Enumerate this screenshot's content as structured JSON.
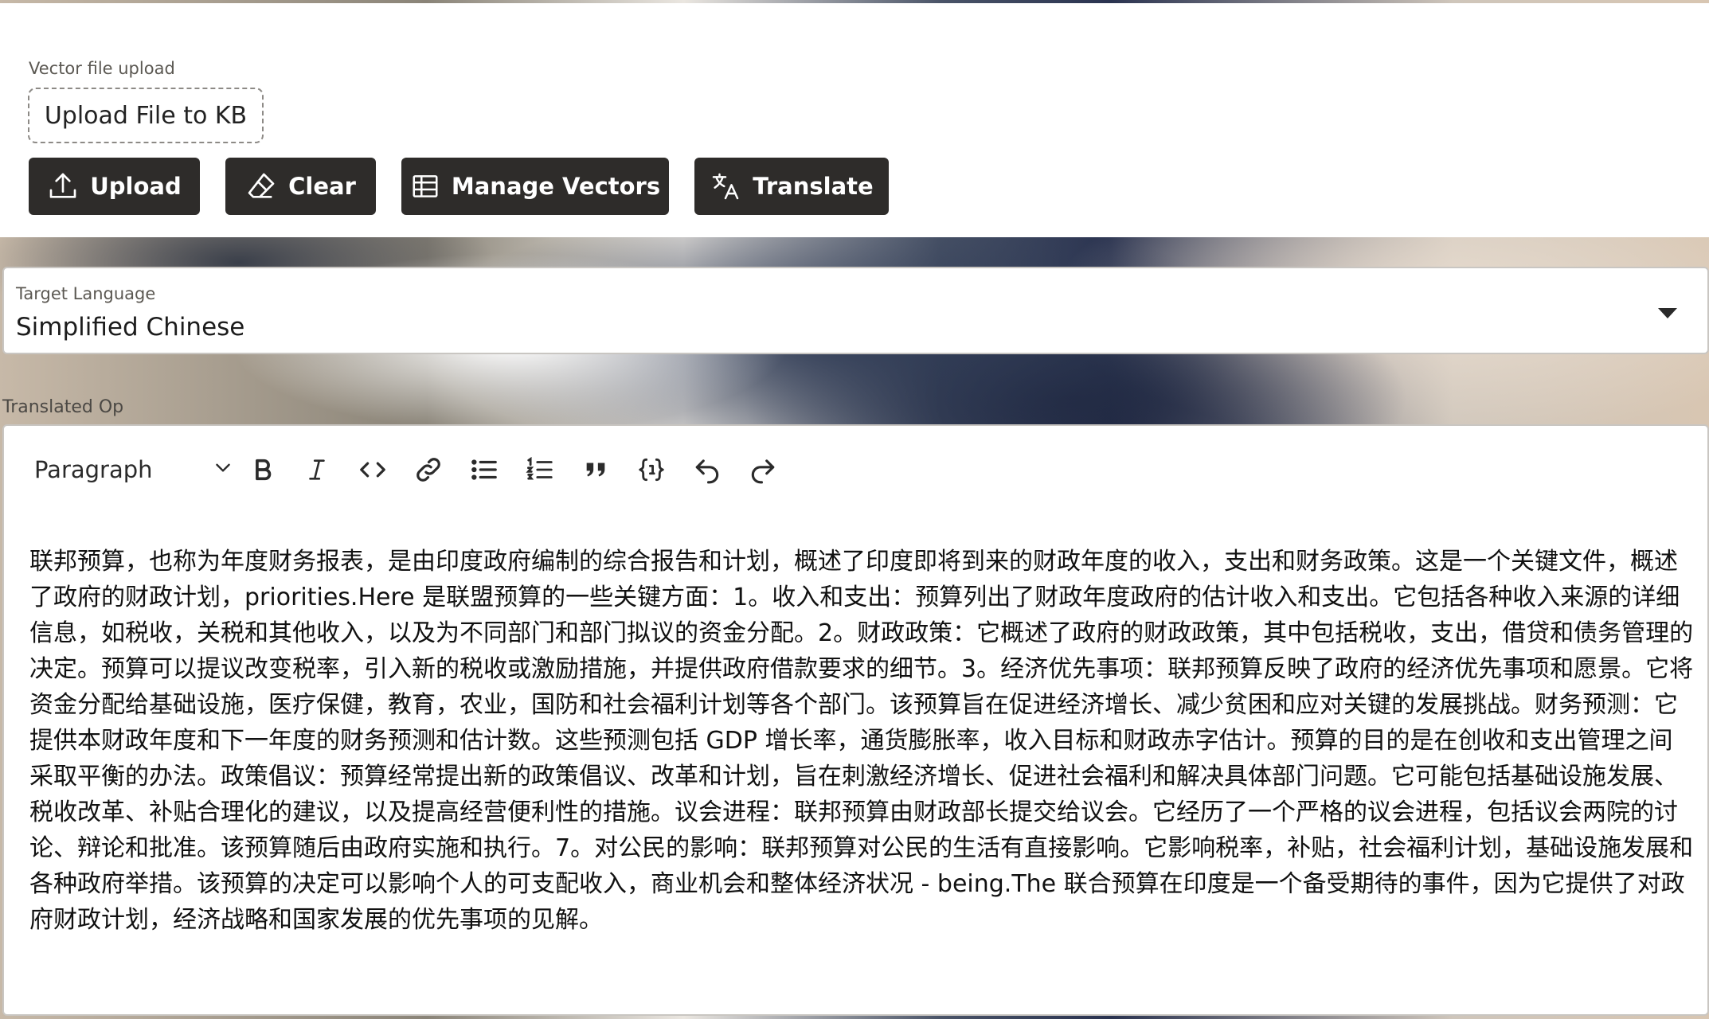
{
  "upload": {
    "label": "Vector file upload",
    "dropzone_text": "Upload File to KB",
    "buttons": {
      "upload": "Upload",
      "clear": "Clear",
      "manage": "Manage Vectors",
      "translate": "Translate"
    }
  },
  "language": {
    "label": "Target Language",
    "selected": "Simplified Chinese"
  },
  "output": {
    "label": "Translated Op",
    "toolbar": {
      "block_format": "Paragraph",
      "icons": [
        "bold-icon",
        "italic-icon",
        "code-icon",
        "link-icon",
        "bulleted-list-icon",
        "numbered-list-icon",
        "blockquote-icon",
        "code-block-icon",
        "undo-icon",
        "redo-icon"
      ]
    },
    "text": "联邦预算，也称为年度财务报表，是由印度政府编制的综合报告和计划，概述了印度即将到来的财政年度的收入，支出和财务政策。这是一个关键文件，概述了政府的财政计划，priorities.Here 是联盟预算的一些关键方面：1。收入和支出：预算列出了财政年度政府的估计收入和支出。它包括各种收入来源的详细信息，如税收，关税和其他收入，以及为不同部门和部门拟议的资金分配。2。财政政策：它概述了政府的财政政策，其中包括税收，支出，借贷和债务管理的决定。预算可以提议改变税率，引入新的税收或激励措施，并提供政府借款要求的细节。3。经济优先事项：联邦预算反映了政府的经济优先事项和愿景。它将资金分配给基础设施，医疗保健，教育，农业，国防和社会福利计划等各个部门。该预算旨在促进经济增长、减少贫困和应对关键的发展挑战。财务预测：它提供本财政年度和下一年度的财务预测和估计数。这些预测包括 GDP 增长率，通货膨胀率，收入目标和财政赤字估计。预算的目的是在创收和支出管理之间采取平衡的办法。政策倡议：预算经常提出新的政策倡议、改革和计划，旨在刺激经济增长、促进社会福利和解决具体部门问题。它可能包括基础设施发展、税收改革、补贴合理化的建议，以及提高经营便利性的措施。议会进程：联邦预算由财政部长提交给议会。它经历了一个严格的议会进程，包括议会两院的讨论、辩论和批准。该预算随后由政府实施和执行。7。对公民的影响：联邦预算对公民的生活有直接影响。它影响税率，补贴，社会福利计划，基础设施发展和各种政府举措。该预算的决定可以影响个人的可支配收入，商业机会和整体经济状况 - being.The 联合预算在印度是一个备受期待的事件，因为它提供了对政府财政计划，经济战略和国家发展的优先事项的见解。"
  }
}
